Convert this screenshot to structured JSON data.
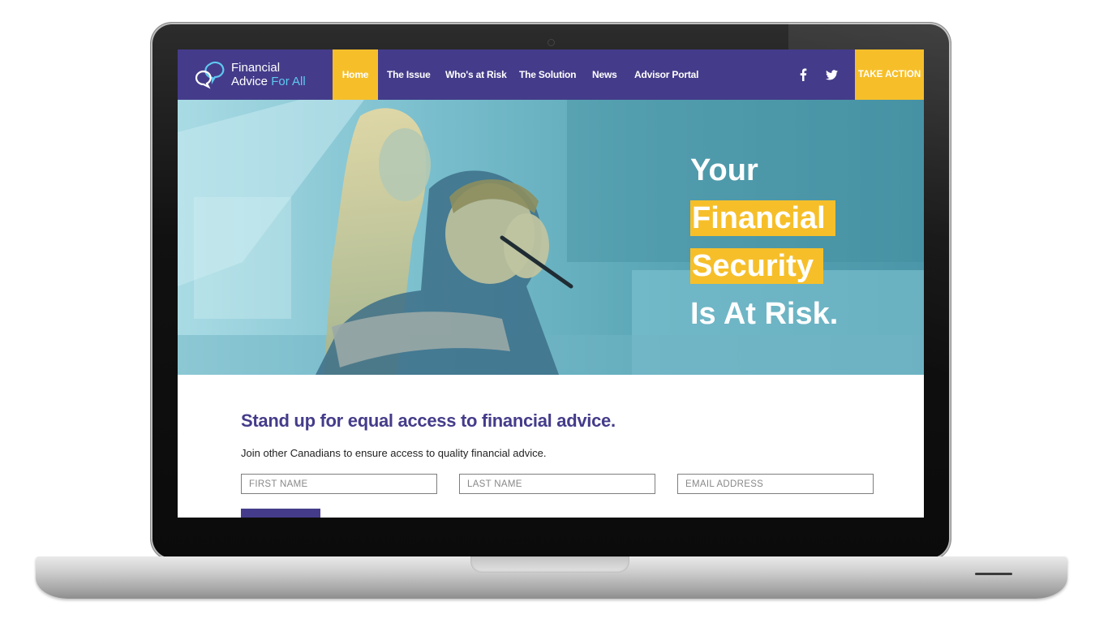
{
  "brand": {
    "line1": "Financial",
    "line2_a": "Advice ",
    "line2_b": "For All",
    "colors": {
      "primary": "#443c8a",
      "accent": "#f6bf2a",
      "logo_accent": "#5fc8f0"
    }
  },
  "nav": {
    "items": [
      {
        "label": "Home",
        "active": true
      },
      {
        "label": "The Issue"
      },
      {
        "label": "Who's at Risk"
      },
      {
        "label": "The Solution"
      },
      {
        "label": "News"
      },
      {
        "label": "Advisor Portal"
      }
    ],
    "social": [
      {
        "icon": "facebook-icon"
      },
      {
        "icon": "twitter-icon"
      }
    ],
    "cta_label": "TAKE ACTION"
  },
  "hero": {
    "line1": "Your",
    "line2": "Financial",
    "line3": "Security",
    "line4": "Is At Risk."
  },
  "signup": {
    "heading": "Stand up for equal access to financial advice.",
    "subtext": "Join other Canadians to ensure access to quality financial advice.",
    "first_name_placeholder": "FIRST NAME",
    "last_name_placeholder": "LAST NAME",
    "email_placeholder": "EMAIL ADDRESS"
  }
}
